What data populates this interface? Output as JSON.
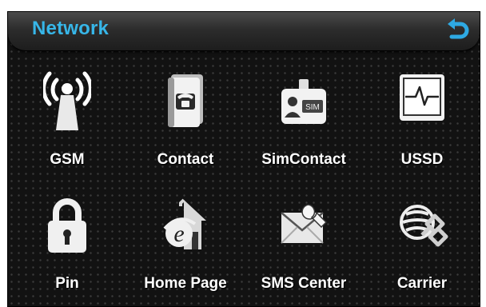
{
  "header": {
    "title": "Network",
    "back_icon": "back-arrow-icon",
    "accent_color": "#37b6e8"
  },
  "tiles": [
    {
      "label": "GSM",
      "icon": "antenna-signal-icon"
    },
    {
      "label": "Contact",
      "icon": "phone-book-icon"
    },
    {
      "label": "SimContact",
      "icon": "sim-card-contact-icon"
    },
    {
      "label": "USSD",
      "icon": "monitor-pulse-icon"
    },
    {
      "label": "Pin",
      "icon": "padlock-icon"
    },
    {
      "label": "Home Page",
      "icon": "browser-home-icon"
    },
    {
      "label": "SMS Center",
      "icon": "envelope-wrench-icon"
    },
    {
      "label": "Carrier",
      "icon": "carrier-knot-icon"
    }
  ]
}
